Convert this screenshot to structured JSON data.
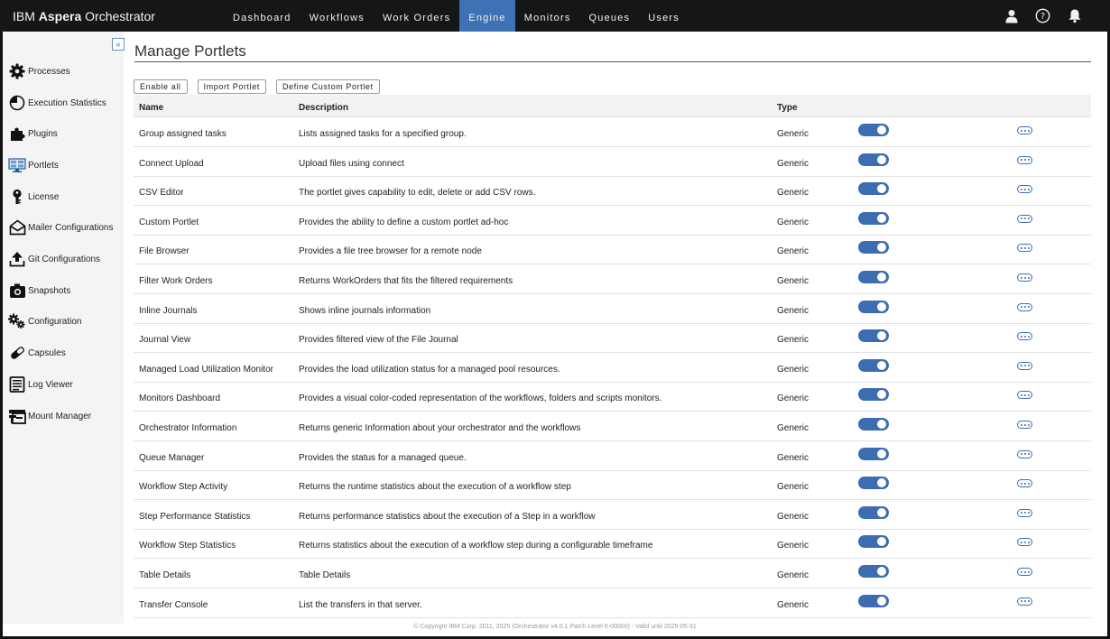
{
  "header": {
    "brand_prefix": "IBM",
    "brand_bold": "Aspera",
    "brand_suffix": "Orchestrator",
    "nav": [
      "Dashboard",
      "Workflows",
      "Work Orders",
      "Engine",
      "Monitors",
      "Queues",
      "Users"
    ],
    "active_nav": "Engine",
    "icons": [
      "user-icon",
      "help-icon",
      "bell-icon"
    ]
  },
  "sidebar": {
    "collapse_label": "«",
    "items": [
      {
        "label": "Processes",
        "icon": "gear-icon"
      },
      {
        "label": "Execution Statistics",
        "icon": "pie-chart-icon"
      },
      {
        "label": "Plugins",
        "icon": "puzzle-icon"
      },
      {
        "label": "Portlets",
        "icon": "portlets-icon"
      },
      {
        "label": "License",
        "icon": "key-icon"
      },
      {
        "label": "Mailer Configurations",
        "icon": "mail-icon"
      },
      {
        "label": "Git Configurations",
        "icon": "upload-icon"
      },
      {
        "label": "Snapshots",
        "icon": "camera-icon"
      },
      {
        "label": "Configuration",
        "icon": "gears-icon"
      },
      {
        "label": "Capsules",
        "icon": "capsule-icon"
      },
      {
        "label": "Log Viewer",
        "icon": "document-icon"
      },
      {
        "label": "Mount Manager",
        "icon": "mount-icon"
      }
    ]
  },
  "main": {
    "title": "Manage Portlets",
    "buttons": [
      "Enable all",
      "Import Portlet",
      "Define Custom Portlet"
    ],
    "columns": {
      "name": "Name",
      "description": "Description",
      "type": "Type"
    },
    "rows": [
      {
        "name": "Group assigned tasks",
        "description": "Lists assigned tasks for a specified group.",
        "type": "Generic",
        "enabled": true
      },
      {
        "name": "Connect Upload",
        "description": "Upload files using connect",
        "type": "Generic",
        "enabled": true
      },
      {
        "name": "CSV Editor",
        "description": "The portlet gives capability to edit, delete or add CSV rows.",
        "type": "Generic",
        "enabled": true
      },
      {
        "name": "Custom Portlet",
        "description": "Provides the ability to define a custom portlet ad-hoc",
        "type": "Generic",
        "enabled": true
      },
      {
        "name": "File Browser",
        "description": "Provides a file tree browser for a remote node",
        "type": "Generic",
        "enabled": true
      },
      {
        "name": "Filter Work Orders",
        "description": "Returns WorkOrders that fits the filtered requirements",
        "type": "Generic",
        "enabled": true
      },
      {
        "name": "Inline Journals",
        "description": "Shows inline journals information",
        "type": "Generic",
        "enabled": true
      },
      {
        "name": "Journal View",
        "description": "Provides filtered view of the File Journal",
        "type": "Generic",
        "enabled": true
      },
      {
        "name": "Managed Load Utilization Monitor",
        "description": "Provides the load utilization status for a managed pool resources.",
        "type": "Generic",
        "enabled": true
      },
      {
        "name": "Monitors Dashboard",
        "description": "Provides a visual color-coded representation of the workflows, folders and scripts monitors.",
        "type": "Generic",
        "enabled": true
      },
      {
        "name": "Orchestrator Information",
        "description": "Returns generic Information about your orchestrator and the workflows",
        "type": "Generic",
        "enabled": true
      },
      {
        "name": "Queue Manager",
        "description": "Provides the status for a managed queue.",
        "type": "Generic",
        "enabled": true
      },
      {
        "name": "Workflow Step Activity",
        "description": "Returns the runtime statistics about the execution of a workflow step",
        "type": "Generic",
        "enabled": true
      },
      {
        "name": "Step Performance Statistics",
        "description": "Returns performance statistics about the execution of a Step in a workflow",
        "type": "Generic",
        "enabled": true
      },
      {
        "name": "Workflow Step Statistics",
        "description": "Returns statistics about the execution of a workflow step during a configurable timeframe",
        "type": "Generic",
        "enabled": true
      },
      {
        "name": "Table Details",
        "description": "Table Details",
        "type": "Generic",
        "enabled": true
      },
      {
        "name": "Transfer Console",
        "description": "List the transfers in that server.",
        "type": "Generic",
        "enabled": true
      }
    ]
  },
  "footer": {
    "text": "© Copyright IBM Corp. 2011, 2025 (Orchestrator v4.0.1.Patch Level 6-00000) - Valid until 2025-05-31"
  },
  "colors": {
    "accent": "#3d72b4",
    "topbar": "#161616",
    "sidebar": "#f4f4f4"
  }
}
